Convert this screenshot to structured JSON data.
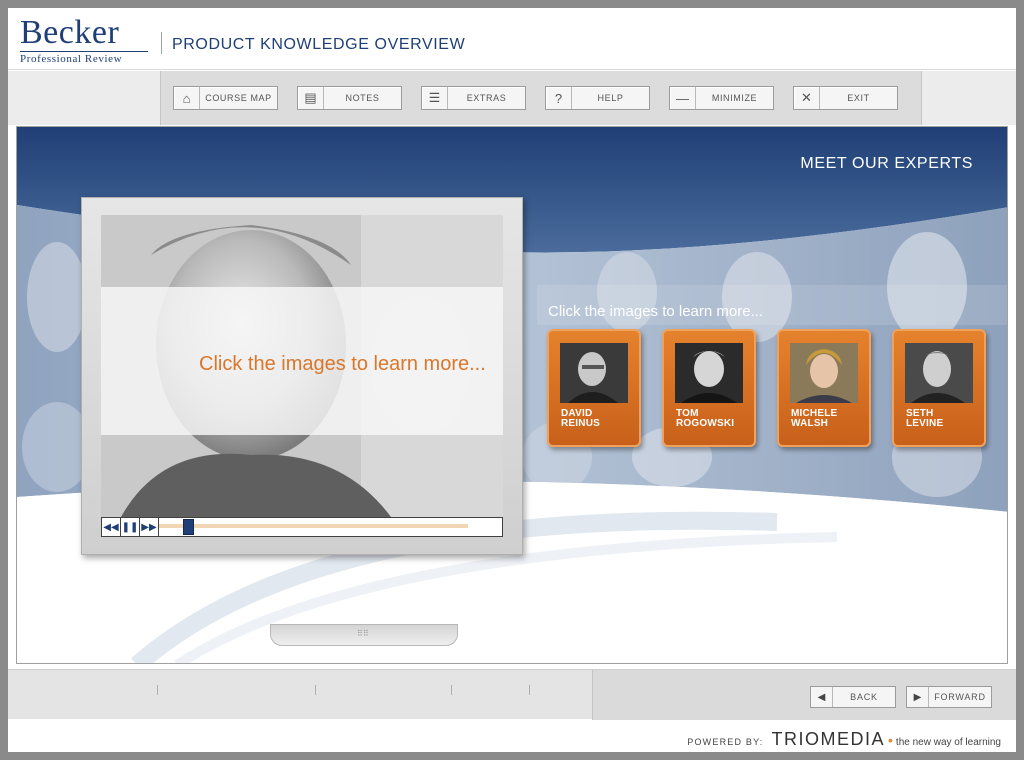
{
  "header": {
    "logo_main": "Becker",
    "logo_sub": "Professional Review",
    "title": "PRODUCT KNOWLEDGE OVERVIEW"
  },
  "toolbar": {
    "buttons": [
      {
        "label": "COURSE MAP",
        "icon": "home-icon"
      },
      {
        "label": "NOTES",
        "icon": "notes-icon"
      },
      {
        "label": "EXTRAS",
        "icon": "extras-icon"
      },
      {
        "label": "HELP",
        "icon": "help-icon"
      },
      {
        "label": "MINIMIZE",
        "icon": "minimize-icon"
      },
      {
        "label": "EXIT",
        "icon": "close-icon"
      }
    ]
  },
  "main": {
    "section_title": "MEET OUR EXPERTS",
    "prompt": "Click the images to learn more...",
    "video": {
      "overlay_text": "Click the images to learn more...",
      "progress": 0.07
    },
    "experts": [
      {
        "first": "DAVID",
        "last": "REINUS"
      },
      {
        "first": "TOM",
        "last": "ROGOWSKI"
      },
      {
        "first": "MICHELE",
        "last": "WALSH"
      },
      {
        "first": "SETH",
        "last": "LEVINE"
      }
    ]
  },
  "footer": {
    "back_label": "BACK",
    "forward_label": "FORWARD",
    "powered_label": "POWERED BY:",
    "brand": "TRIOMEDIA",
    "tagline": "the new way of learning"
  },
  "colors": {
    "brand_blue": "#1f3f76",
    "accent_orange": "#d9772a",
    "banner_blue": "#3d5f91"
  }
}
